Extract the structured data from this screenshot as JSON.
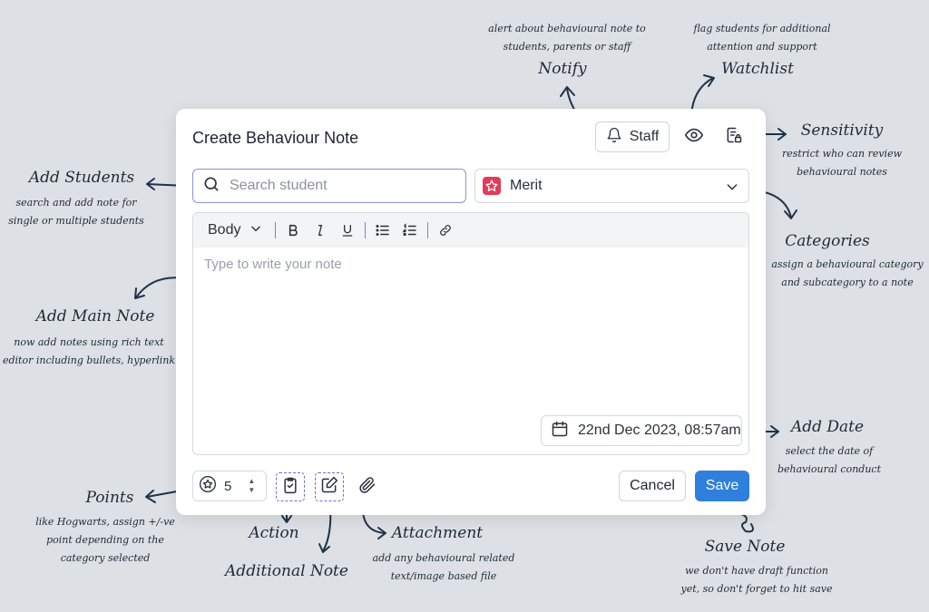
{
  "modal": {
    "title": "Create Behaviour Note",
    "staff_label": "Staff",
    "search_placeholder": "Search student",
    "category_value": "Merit",
    "editor_style": "Body",
    "editor_placeholder": "Type to write your note",
    "date_value": "22nd Dec 2023, 08:57am",
    "points_value": "5",
    "cancel_label": "Cancel",
    "save_label": "Save"
  },
  "icons": {
    "staff": "bell-icon",
    "watchlist": "eye-icon",
    "sensitivity": "sensitivity-icon",
    "search": "search-icon",
    "category": "star-icon",
    "dropdown": "chevron-down-icon",
    "date": "calendar-icon",
    "points": "star-circle-icon",
    "action": "clipboard-check-icon",
    "additional_note": "edit-icon",
    "attachment": "paperclip-icon"
  },
  "annotations": {
    "notify": {
      "title": "Notify",
      "line1": "alert about behavioural note to",
      "line2": "students, parents or staff"
    },
    "watchlist": {
      "title": "Watchlist",
      "line1": "flag students for additional",
      "line2": "attention and support"
    },
    "sensitivity": {
      "title": "Sensitivity",
      "line1": "restrict who can review",
      "line2": "behavioural notes"
    },
    "add_students": {
      "title": "Add Students",
      "line1": "search and add note for",
      "line2": "single or multiple students"
    },
    "categories": {
      "title": "Categories",
      "line1": "assign a behavioural category",
      "line2": "and subcategory to a note"
    },
    "add_main_note": {
      "title": "Add Main Note",
      "line1": "now add notes using rich text",
      "line2": "editor including bullets, hyperlink"
    },
    "add_date": {
      "title": "Add Date",
      "line1": "select the date of",
      "line2": "behavioural conduct"
    },
    "points": {
      "title": "Points",
      "line1": "like Hogwarts, assign +/-ve",
      "line2": "point depending on the",
      "line3": "category selected"
    },
    "action": {
      "title": "Action"
    },
    "additional_note": {
      "title": "Additional Note"
    },
    "attachment": {
      "title": "Attachment",
      "line1": "add any behavioural related",
      "line2": "text/image based file"
    },
    "save_note": {
      "title": "Save Note",
      "line1": "we don't have draft function",
      "line2": "yet, so don't forget to hit save"
    }
  },
  "colors": {
    "background": "#dde0e5",
    "save_button": "#2f7fdc",
    "category_icon": "#e23b5a",
    "focus_border": "#8a93d8",
    "dashed_border": "#6a73c9"
  }
}
